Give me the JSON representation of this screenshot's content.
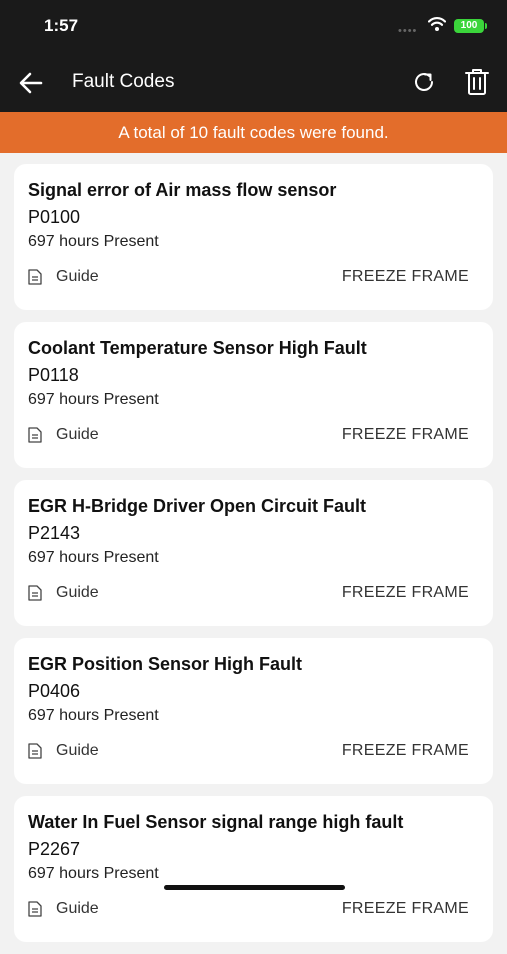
{
  "status_bar": {
    "time": "1:57",
    "battery": "100"
  },
  "header": {
    "title": "Fault Codes"
  },
  "banner": {
    "text": "A total of 10 fault codes were found."
  },
  "colors": {
    "accent": "#e36d2b",
    "header_bg": "#1a1a1a",
    "battery": "#3bd53b"
  },
  "icons": [
    "back-arrow-icon",
    "refresh-icon",
    "trash-icon",
    "document-icon",
    "wifi-icon"
  ],
  "faults": [
    {
      "title": "Signal error of Air mass flow sensor",
      "code": "P0100",
      "status": "697 hours Present",
      "guide_label": "Guide",
      "freeze_label": "FREEZE FRAME"
    },
    {
      "title": "Coolant Temperature Sensor High Fault",
      "code": "P0118",
      "status": "697 hours Present",
      "guide_label": "Guide",
      "freeze_label": "FREEZE FRAME"
    },
    {
      "title": "EGR H-Bridge Driver Open Circuit Fault",
      "code": "P2143",
      "status": "697 hours Present",
      "guide_label": "Guide",
      "freeze_label": "FREEZE FRAME"
    },
    {
      "title": "EGR Position Sensor High Fault",
      "code": "P0406",
      "status": "697 hours Present",
      "guide_label": "Guide",
      "freeze_label": "FREEZE FRAME"
    },
    {
      "title": "Water In Fuel Sensor signal range high fault",
      "code": "P2267",
      "status": "697 hours Present",
      "guide_label": "Guide",
      "freeze_label": "FREEZE FRAME"
    }
  ]
}
